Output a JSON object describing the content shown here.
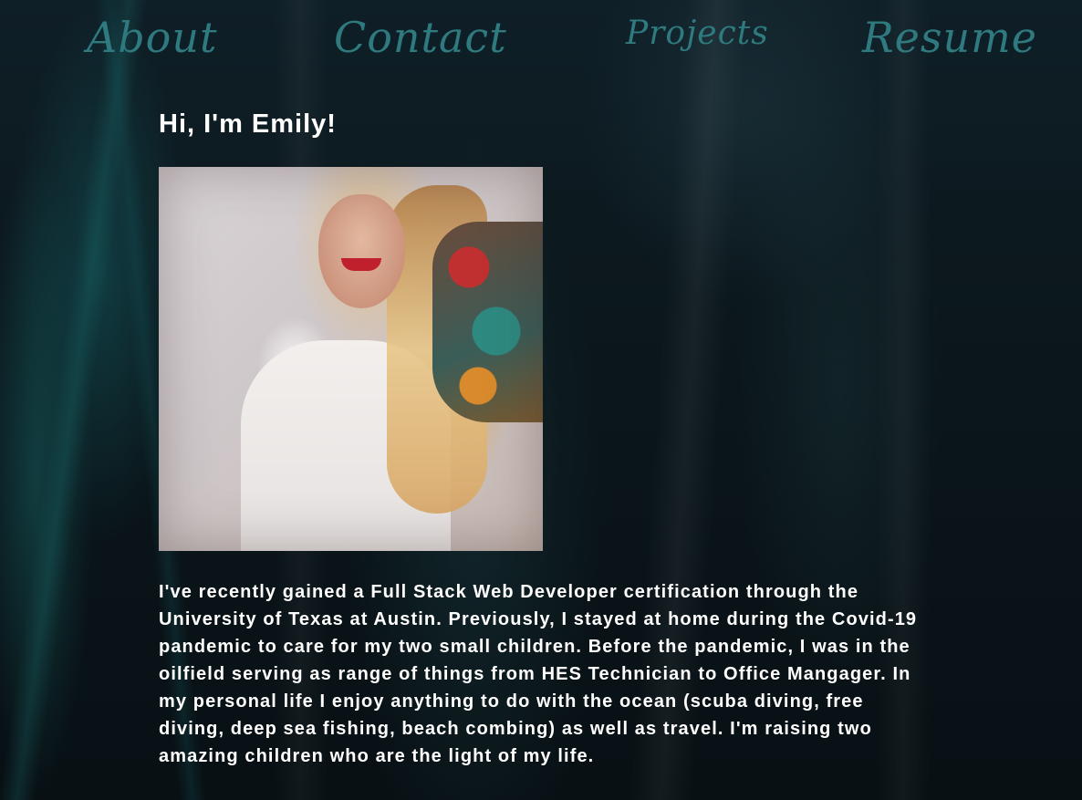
{
  "nav": {
    "items": [
      {
        "label": "About"
      },
      {
        "label": "Contact"
      },
      {
        "label": "Projects"
      },
      {
        "label": "Resume"
      }
    ]
  },
  "main": {
    "heading": "Hi, I'm Emily!",
    "photo_icon": "profile-photo",
    "bio": "I've recently gained a Full Stack Web Developer certification through the University of Texas at Austin. Previously, I stayed at home during the Covid-19 pandemic to care for my two small children. Before the pandemic, I was in the oilfield serving as range of things from HES Technician to Office Mangager. In my personal life I enjoy anything to do with the ocean (scuba diving, free diving, deep sea fishing, beach combing) as well as travel. I'm raising two amazing children who are the light of my life."
  },
  "colors": {
    "nav_link": "#2e7a7f",
    "text": "#ffffff",
    "background": "#0b171c"
  }
}
